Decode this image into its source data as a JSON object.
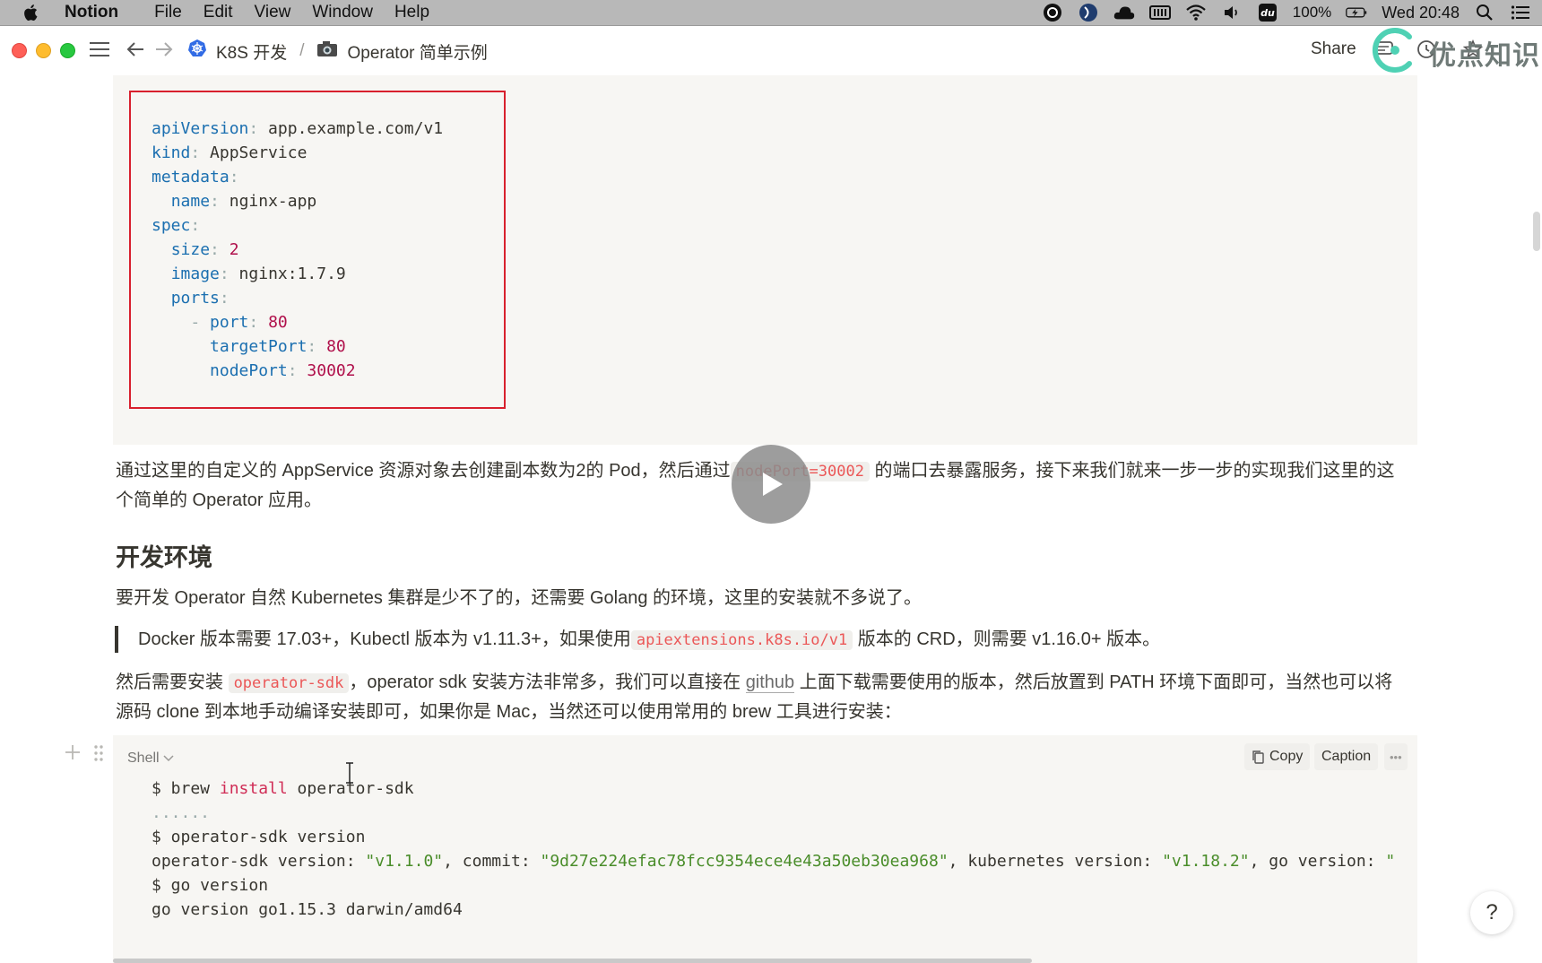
{
  "menubar": {
    "app_name": "Notion",
    "menus": [
      "File",
      "Edit",
      "View",
      "Window",
      "Help"
    ],
    "battery": "100%",
    "clock": "Wed 20:48"
  },
  "titlebar": {
    "breadcrumb": [
      "K8S 开发",
      "Operator 简单示例"
    ],
    "separator": "/",
    "share_label": "Share",
    "watermark": "优点知识"
  },
  "yaml_code": [
    [
      [
        "k",
        "apiVersion"
      ],
      [
        "p",
        ":"
      ],
      [
        "t",
        " app.example.com/v1"
      ]
    ],
    [
      [
        "k",
        "kind"
      ],
      [
        "p",
        ":"
      ],
      [
        "t",
        " AppService"
      ]
    ],
    [
      [
        "k",
        "metadata"
      ],
      [
        "p",
        ":"
      ]
    ],
    [
      [
        "t",
        "  "
      ],
      [
        "k",
        "name"
      ],
      [
        "p",
        ":"
      ],
      [
        "t",
        " nginx-app"
      ]
    ],
    [
      [
        "k",
        "spec"
      ],
      [
        "p",
        ":"
      ]
    ],
    [
      [
        "t",
        "  "
      ],
      [
        "k",
        "size"
      ],
      [
        "p",
        ":"
      ],
      [
        "t",
        " "
      ],
      [
        "n",
        "2"
      ]
    ],
    [
      [
        "t",
        "  "
      ],
      [
        "k",
        "image"
      ],
      [
        "p",
        ":"
      ],
      [
        "t",
        " nginx:1.7.9"
      ]
    ],
    [
      [
        "t",
        "  "
      ],
      [
        "k",
        "ports"
      ],
      [
        "p",
        ":"
      ]
    ],
    [
      [
        "t",
        "    "
      ],
      [
        "p",
        "-"
      ],
      [
        "t",
        " "
      ],
      [
        "k",
        "port"
      ],
      [
        "p",
        ":"
      ],
      [
        "t",
        " "
      ],
      [
        "n",
        "80"
      ]
    ],
    [
      [
        "t",
        "      "
      ],
      [
        "k",
        "targetPort"
      ],
      [
        "p",
        ":"
      ],
      [
        "t",
        " "
      ],
      [
        "n",
        "80"
      ]
    ],
    [
      [
        "t",
        "      "
      ],
      [
        "k",
        "nodePort"
      ],
      [
        "p",
        ":"
      ],
      [
        "t",
        " "
      ],
      [
        "n",
        "30002"
      ]
    ]
  ],
  "para1": {
    "before": "通过这里的自定义的 AppService 资源对象去创建副本数为2的 Pod，然后通过",
    "code": "nodePort=30002",
    "after": " 的端口去暴露服务，接下来我们就来一步一步的实现我们这里的这个简单的 Operator 应用。"
  },
  "heading": "开发环境",
  "para2": "要开发 Operator 自然 Kubernetes 集群是少不了的，还需要 Golang 的环境，这里的安装就不多说了。",
  "quote": {
    "before": "Docker 版本需要 17.03+，Kubectl 版本为 v1.11.3+，如果使用",
    "code": "apiextensions.k8s.io/v1",
    "after": " 版本的 CRD，则需要 v1.16.0+ 版本。"
  },
  "para3": {
    "before": "然后需要安装 ",
    "code": "operator-sdk",
    "middle": "，operator sdk 安装方法非常多，我们可以直接在 ",
    "link": "github",
    "after": " 上面下载需要使用的版本，然后放置到 PATH 环境下面即可，当然也可以将源码 clone 到本地手动编译安装即可，如果你是 Mac，当然还可以使用常用的 brew 工具进行安装："
  },
  "shell_block": {
    "language": "Shell",
    "copy_label": "Copy",
    "caption_label": "Caption",
    "more_label": "•••",
    "lines": [
      [
        [
          "t",
          "$ brew "
        ],
        [
          "kw",
          "install"
        ],
        [
          "t",
          " operator-sdk"
        ]
      ],
      [
        [
          "p",
          "......"
        ]
      ],
      [
        [
          "t",
          "$ operator-sdk version"
        ]
      ],
      [
        [
          "t",
          "operator-sdk version: "
        ],
        [
          "s",
          "\"v1.1.0\""
        ],
        [
          "t",
          ", commit: "
        ],
        [
          "s",
          "\"9d27e224efac78fcc9354ece4e43a50eb30ea968\""
        ],
        [
          "t",
          ", kubernetes version: "
        ],
        [
          "s",
          "\"v1.18.2\""
        ],
        [
          "t",
          ", go version: "
        ],
        [
          "s",
          "\""
        ]
      ],
      [
        [
          "t",
          "$ go version"
        ]
      ],
      [
        [
          "t",
          "go version go1.15.3 darwin/amd64"
        ]
      ]
    ]
  },
  "help_label": "?",
  "icons": [
    "apple-icon",
    "hamburger-icon",
    "back-arrow-icon",
    "forward-arrow-icon",
    "kubernetes-icon",
    "camera-icon",
    "comments-icon",
    "history-icon",
    "star-icon",
    "play-icon",
    "copy-icon",
    "plus-icon",
    "drag-handle-icon",
    "wifi-icon",
    "volume-icon",
    "search-icon",
    "list-icon",
    "battery-icon"
  ],
  "colors": {
    "code_bg": "#f7f6f3",
    "inline_code": "#eb5757",
    "highlight_border": "#d8202d",
    "yaml_key": "#1b6fb0",
    "yaml_number": "#b0104b",
    "string": "#4a8d2a"
  }
}
